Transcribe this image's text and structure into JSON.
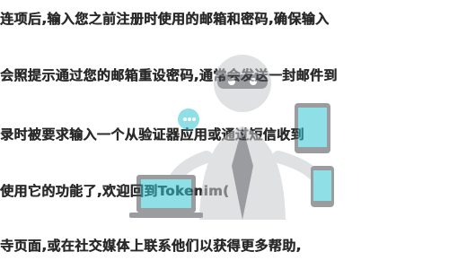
{
  "text_lines": [
    "连项后,输入您之前注册时使用的邮箱和密码,确保输入",
    "会照提示通过您的邮箱重设密码,通常会发送一封邮件到",
    "录时被要求输入一个从验证器应用或通过短信收到",
    "使用它的功能了,欢迎回到Tokenim(",
    "寺页面,或在社交媒体上联系他们以获得更多帮助,"
  ],
  "colors": {
    "text": "#2a2a2a",
    "watermark_body": "#c7c9cc",
    "watermark_dark": "#4a4d52",
    "watermark_teal": "#35c6d3"
  },
  "watermark": {
    "icon": "hacker-thief-illustration",
    "devices": [
      "laptop-icon",
      "tablet-icon",
      "smartphone-icon"
    ]
  }
}
